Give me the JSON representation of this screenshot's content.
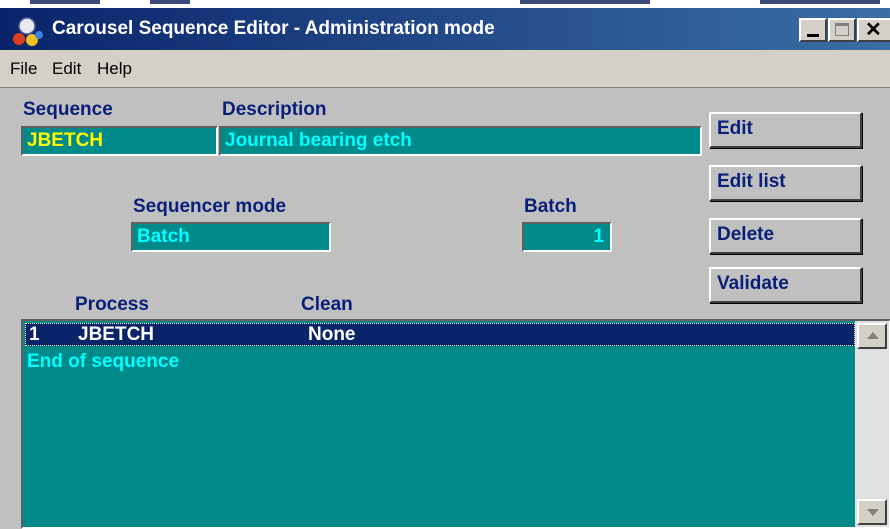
{
  "window": {
    "title": "Carousel Sequence Editor - Administration mode"
  },
  "menu": [
    "File",
    "Edit",
    "Help"
  ],
  "form": {
    "sequence_label": "Sequence",
    "sequence_value": "JBETCH",
    "description_label": "Description",
    "description_value": "Journal bearing etch",
    "sequencer_mode_label": "Sequencer mode",
    "sequencer_mode_value": "Batch",
    "batch_label": "Batch",
    "batch_value": "1"
  },
  "buttons": {
    "edit": "Edit",
    "edit_list": "Edit list",
    "delete": "Delete",
    "validate": "Validate"
  },
  "list": {
    "process_header": "Process",
    "clean_header": "Clean",
    "rows": [
      {
        "index": "1",
        "process": "JBETCH",
        "clean": "None"
      }
    ],
    "end_text": "End of sequence"
  },
  "colors": {
    "titlebar_start": "#0a246a",
    "titlebar_end": "#3a6ea5",
    "field_bg": "#008a8a",
    "label_text": "#0a1f7a",
    "highlight_text": "#ffff00",
    "cyan_text": "#00ffff"
  }
}
